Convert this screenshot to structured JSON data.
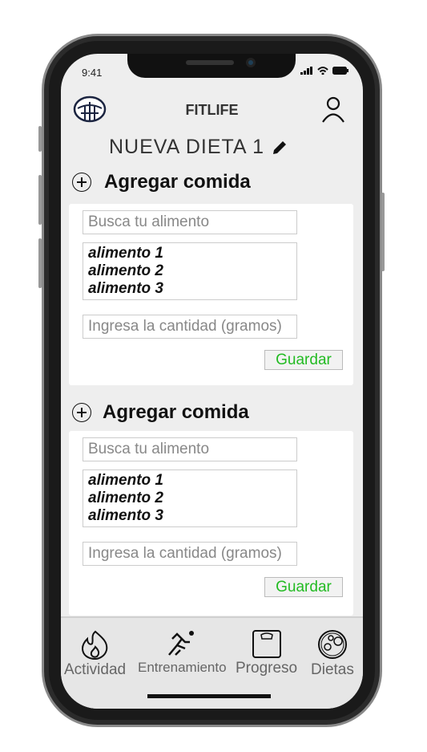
{
  "status_bar": {
    "time": "9:41"
  },
  "header": {
    "app_title": "FITLIFE",
    "diet_title": "NUEVA DIETA 1"
  },
  "sections": [
    {
      "heading": "Agregar comida",
      "search_placeholder": "Busca tu alimento",
      "foods": [
        "alimento 1",
        "alimento 2",
        "alimento 3"
      ],
      "quantity_placeholder": "Ingresa la cantidad (gramos)",
      "save_label": "Guardar"
    },
    {
      "heading": "Agregar comida",
      "search_placeholder": "Busca tu alimento",
      "foods": [
        "alimento 1",
        "alimento 2",
        "alimento 3"
      ],
      "quantity_placeholder": "Ingresa la cantidad (gramos)",
      "save_label": "Guardar"
    }
  ],
  "nav": [
    {
      "label": "Actividad",
      "icon": "flame-icon"
    },
    {
      "label": "Entrenamiento",
      "icon": "runner-icon"
    },
    {
      "label": "Progreso",
      "icon": "scale-icon"
    },
    {
      "label": "Dietas",
      "icon": "food-plate-icon"
    }
  ],
  "colors": {
    "save_text": "#22bb22",
    "screen_bg": "#eeeeee"
  }
}
